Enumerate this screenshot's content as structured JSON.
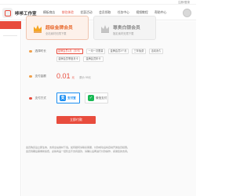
{
  "top_strip": {
    "link": "注册/登录"
  },
  "header": {
    "brand": "哆哆工作室",
    "nav": [
      "模板商店",
      "前往体验",
      "优惠活动",
      "会员领取",
      "任务中心",
      "视频教程",
      "帮助中心"
    ],
    "active_nav_index": 1
  },
  "cards": {
    "gold": {
      "title": "超级金牌会员",
      "subtitle": "全站素材无限下载"
    },
    "silver": {
      "title": "尊贵白银会员",
      "subtitle": "指定素材无限下载"
    }
  },
  "durations": {
    "label": "选择时长",
    "items": [
      "金牌会员1月（月卡）",
      "一月一次限量",
      "金牌会员3个月",
      "三年免费",
      "活动永久",
      "金牌会员季度月卡",
      "金牌会员年卡"
    ],
    "selected_index": 0
  },
  "price": {
    "label": "支付金额",
    "value": "0.01",
    "unit": "元",
    "original": "原价 99元"
  },
  "payment": {
    "label": "支付方式",
    "alipay_label": "支付宝",
    "wechat_label": "微信支付",
    "selected": "alipay"
  },
  "pay_button": "立即付款",
  "notes": [
    "会员购买后立即生效，支持全站素材下载。如有疑问请联系客服，付款成功后将自动开通会员权限。",
    "会员到期后需重新续费，虚拟商品一经售出不支持退款，请确认后再进行付款操作，感谢您的支持。"
  ],
  "colors": {
    "accent": "#e84c3d",
    "alipay": "#1a8ef1",
    "wechat": "#19b955",
    "gold": "#e86a2f"
  },
  "icons": {
    "logo": "logo-icon",
    "crown": "crown-icon",
    "alipay": "alipay-icon",
    "wechat": "wechat-icon"
  }
}
